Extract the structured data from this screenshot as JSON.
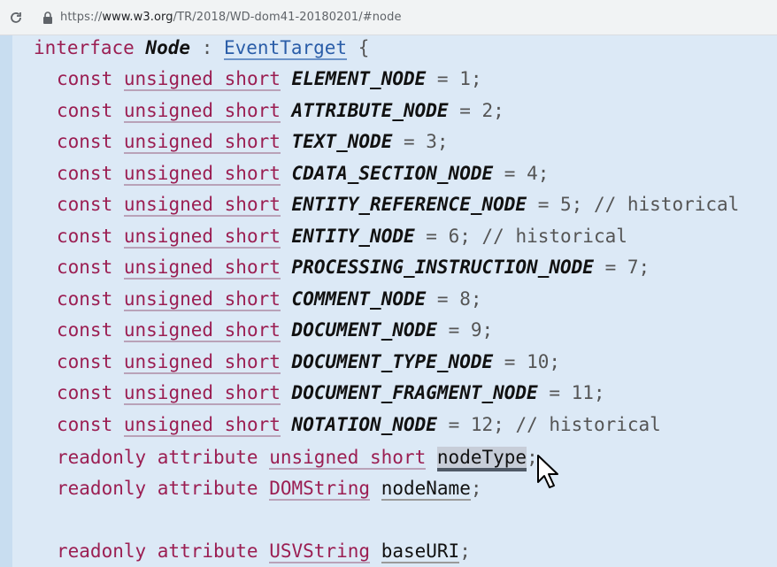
{
  "browser": {
    "reload_icon": "reload-icon",
    "lock_icon": "lock-icon",
    "url_scheme": "https://",
    "url_host": "www.w3.org",
    "url_path": "/TR/2018/WD-dom41-20180201/#node"
  },
  "code": {
    "header": {
      "keyword": "interface",
      "name": "Node",
      "colon": ":",
      "parent": "EventTarget",
      "brace": "{"
    },
    "const_keyword": "const",
    "const_type": "unsigned short",
    "constants": [
      {
        "name": "ELEMENT_NODE",
        "value": "= 1;",
        "comment": ""
      },
      {
        "name": "ATTRIBUTE_NODE",
        "value": "= 2;",
        "comment": ""
      },
      {
        "name": "TEXT_NODE",
        "value": "= 3;",
        "comment": ""
      },
      {
        "name": "CDATA_SECTION_NODE",
        "value": "= 4;",
        "comment": ""
      },
      {
        "name": "ENTITY_REFERENCE_NODE",
        "value": "= 5;",
        "comment": "// historical"
      },
      {
        "name": "ENTITY_NODE",
        "value": "= 6;",
        "comment": "// historical"
      },
      {
        "name": "PROCESSING_INSTRUCTION_NODE",
        "value": "= 7;",
        "comment": ""
      },
      {
        "name": "COMMENT_NODE",
        "value": "= 8;",
        "comment": ""
      },
      {
        "name": "DOCUMENT_NODE",
        "value": "= 9;",
        "comment": ""
      },
      {
        "name": "DOCUMENT_TYPE_NODE",
        "value": "= 10;",
        "comment": ""
      },
      {
        "name": "DOCUMENT_FRAGMENT_NODE",
        "value": "= 11;",
        "comment": ""
      },
      {
        "name": "NOTATION_NODE",
        "value": "= 12;",
        "comment": "// historical"
      }
    ],
    "attributes": [
      {
        "keyword": "readonly attribute",
        "type": "unsigned short",
        "name": "nodeType",
        "semicolon": ";"
      },
      {
        "keyword": "readonly attribute",
        "type": "DOMString",
        "name": "nodeName",
        "semicolon": ";"
      },
      {
        "keyword": "readonly attribute",
        "type": "USVString",
        "name": "baseURI",
        "semicolon": ";"
      }
    ]
  },
  "cursor_icon": "mouse-pointer-icon"
}
